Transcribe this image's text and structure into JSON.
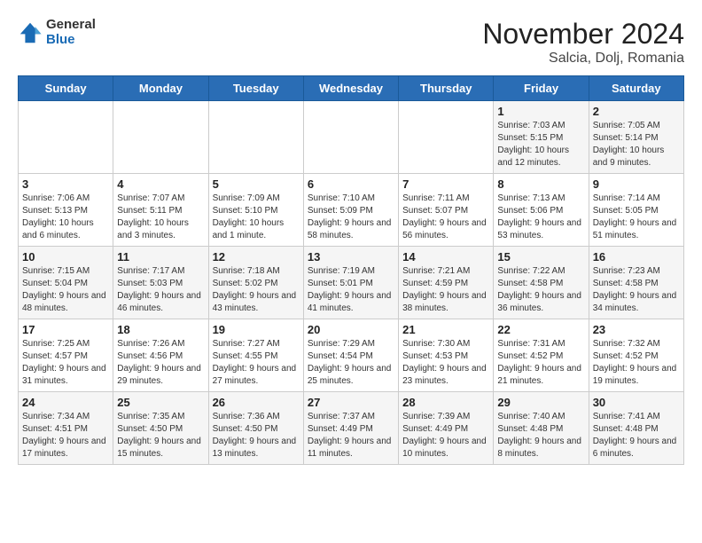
{
  "logo": {
    "general": "General",
    "blue": "Blue"
  },
  "header": {
    "month": "November 2024",
    "location": "Salcia, Dolj, Romania"
  },
  "weekdays": [
    "Sunday",
    "Monday",
    "Tuesday",
    "Wednesday",
    "Thursday",
    "Friday",
    "Saturday"
  ],
  "weeks": [
    [
      {
        "day": "",
        "info": ""
      },
      {
        "day": "",
        "info": ""
      },
      {
        "day": "",
        "info": ""
      },
      {
        "day": "",
        "info": ""
      },
      {
        "day": "",
        "info": ""
      },
      {
        "day": "1",
        "info": "Sunrise: 7:03 AM\nSunset: 5:15 PM\nDaylight: 10 hours and 12 minutes."
      },
      {
        "day": "2",
        "info": "Sunrise: 7:05 AM\nSunset: 5:14 PM\nDaylight: 10 hours and 9 minutes."
      }
    ],
    [
      {
        "day": "3",
        "info": "Sunrise: 7:06 AM\nSunset: 5:13 PM\nDaylight: 10 hours and 6 minutes."
      },
      {
        "day": "4",
        "info": "Sunrise: 7:07 AM\nSunset: 5:11 PM\nDaylight: 10 hours and 3 minutes."
      },
      {
        "day": "5",
        "info": "Sunrise: 7:09 AM\nSunset: 5:10 PM\nDaylight: 10 hours and 1 minute."
      },
      {
        "day": "6",
        "info": "Sunrise: 7:10 AM\nSunset: 5:09 PM\nDaylight: 9 hours and 58 minutes."
      },
      {
        "day": "7",
        "info": "Sunrise: 7:11 AM\nSunset: 5:07 PM\nDaylight: 9 hours and 56 minutes."
      },
      {
        "day": "8",
        "info": "Sunrise: 7:13 AM\nSunset: 5:06 PM\nDaylight: 9 hours and 53 minutes."
      },
      {
        "day": "9",
        "info": "Sunrise: 7:14 AM\nSunset: 5:05 PM\nDaylight: 9 hours and 51 minutes."
      }
    ],
    [
      {
        "day": "10",
        "info": "Sunrise: 7:15 AM\nSunset: 5:04 PM\nDaylight: 9 hours and 48 minutes."
      },
      {
        "day": "11",
        "info": "Sunrise: 7:17 AM\nSunset: 5:03 PM\nDaylight: 9 hours and 46 minutes."
      },
      {
        "day": "12",
        "info": "Sunrise: 7:18 AM\nSunset: 5:02 PM\nDaylight: 9 hours and 43 minutes."
      },
      {
        "day": "13",
        "info": "Sunrise: 7:19 AM\nSunset: 5:01 PM\nDaylight: 9 hours and 41 minutes."
      },
      {
        "day": "14",
        "info": "Sunrise: 7:21 AM\nSunset: 4:59 PM\nDaylight: 9 hours and 38 minutes."
      },
      {
        "day": "15",
        "info": "Sunrise: 7:22 AM\nSunset: 4:58 PM\nDaylight: 9 hours and 36 minutes."
      },
      {
        "day": "16",
        "info": "Sunrise: 7:23 AM\nSunset: 4:58 PM\nDaylight: 9 hours and 34 minutes."
      }
    ],
    [
      {
        "day": "17",
        "info": "Sunrise: 7:25 AM\nSunset: 4:57 PM\nDaylight: 9 hours and 31 minutes."
      },
      {
        "day": "18",
        "info": "Sunrise: 7:26 AM\nSunset: 4:56 PM\nDaylight: 9 hours and 29 minutes."
      },
      {
        "day": "19",
        "info": "Sunrise: 7:27 AM\nSunset: 4:55 PM\nDaylight: 9 hours and 27 minutes."
      },
      {
        "day": "20",
        "info": "Sunrise: 7:29 AM\nSunset: 4:54 PM\nDaylight: 9 hours and 25 minutes."
      },
      {
        "day": "21",
        "info": "Sunrise: 7:30 AM\nSunset: 4:53 PM\nDaylight: 9 hours and 23 minutes."
      },
      {
        "day": "22",
        "info": "Sunrise: 7:31 AM\nSunset: 4:52 PM\nDaylight: 9 hours and 21 minutes."
      },
      {
        "day": "23",
        "info": "Sunrise: 7:32 AM\nSunset: 4:52 PM\nDaylight: 9 hours and 19 minutes."
      }
    ],
    [
      {
        "day": "24",
        "info": "Sunrise: 7:34 AM\nSunset: 4:51 PM\nDaylight: 9 hours and 17 minutes."
      },
      {
        "day": "25",
        "info": "Sunrise: 7:35 AM\nSunset: 4:50 PM\nDaylight: 9 hours and 15 minutes."
      },
      {
        "day": "26",
        "info": "Sunrise: 7:36 AM\nSunset: 4:50 PM\nDaylight: 9 hours and 13 minutes."
      },
      {
        "day": "27",
        "info": "Sunrise: 7:37 AM\nSunset: 4:49 PM\nDaylight: 9 hours and 11 minutes."
      },
      {
        "day": "28",
        "info": "Sunrise: 7:39 AM\nSunset: 4:49 PM\nDaylight: 9 hours and 10 minutes."
      },
      {
        "day": "29",
        "info": "Sunrise: 7:40 AM\nSunset: 4:48 PM\nDaylight: 9 hours and 8 minutes."
      },
      {
        "day": "30",
        "info": "Sunrise: 7:41 AM\nSunset: 4:48 PM\nDaylight: 9 hours and 6 minutes."
      }
    ]
  ]
}
